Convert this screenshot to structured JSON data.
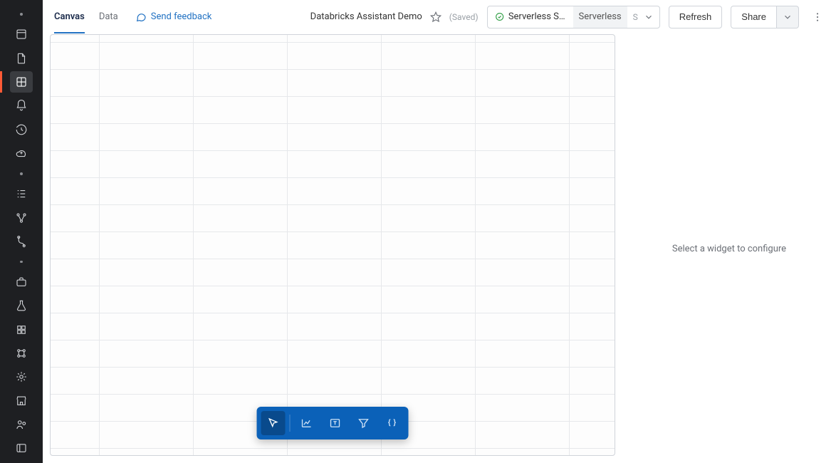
{
  "header": {
    "tabs": [
      {
        "label": "Canvas",
        "active": true
      },
      {
        "label": "Data",
        "active": false
      }
    ],
    "feedback_label": "Send feedback",
    "dashboard_title": "Databricks Assistant Demo",
    "saved_label": "(Saved)",
    "compute": {
      "status_label": "Serverless Sta…",
      "warehouse_label": "Serverless",
      "size_label": "S"
    },
    "refresh_label": "Refresh",
    "share_label": "Share"
  },
  "right_pane": {
    "placeholder": "Select a widget to configure"
  },
  "toolbox": {
    "tools": [
      {
        "name": "cursor",
        "active": true
      },
      {
        "name": "chart",
        "active": false
      },
      {
        "name": "text",
        "active": false
      },
      {
        "name": "filter",
        "active": false
      },
      {
        "name": "code",
        "active": false
      }
    ]
  },
  "leftnav": {
    "groups": [
      [
        "home",
        "new-file",
        "dashboards-active",
        "alerts",
        "history",
        "compute"
      ],
      [
        "tasks",
        "pipeline",
        "workflows"
      ],
      [
        "jobs",
        "experiments",
        "models",
        "features",
        "serving"
      ],
      [
        "marketplace",
        "partner"
      ]
    ],
    "bottom": [
      "menu"
    ]
  }
}
